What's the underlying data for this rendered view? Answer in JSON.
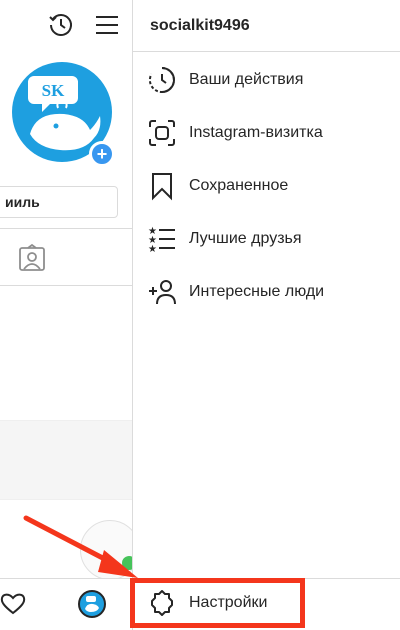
{
  "profile": {
    "edit_profile_label": "ииль",
    "avatar_initials": "SK"
  },
  "drawer": {
    "username": "socialkit9496",
    "menu": [
      {
        "label": "Ваши действия",
        "icon": "activity-clock-icon"
      },
      {
        "label": "Instagram-визитка",
        "icon": "nametag-scan-icon"
      },
      {
        "label": "Сохраненное",
        "icon": "bookmark-icon"
      },
      {
        "label": "Лучшие друзья",
        "icon": "close-friends-list-icon"
      },
      {
        "label": "Интересные люди",
        "icon": "discover-people-icon"
      }
    ],
    "settings_label": "Настройки",
    "settings_icon": "gear-icon"
  },
  "colors": {
    "highlight": "#f4361c",
    "avatar_bg": "#1e9fe0",
    "accent_blue": "#3897f0"
  }
}
